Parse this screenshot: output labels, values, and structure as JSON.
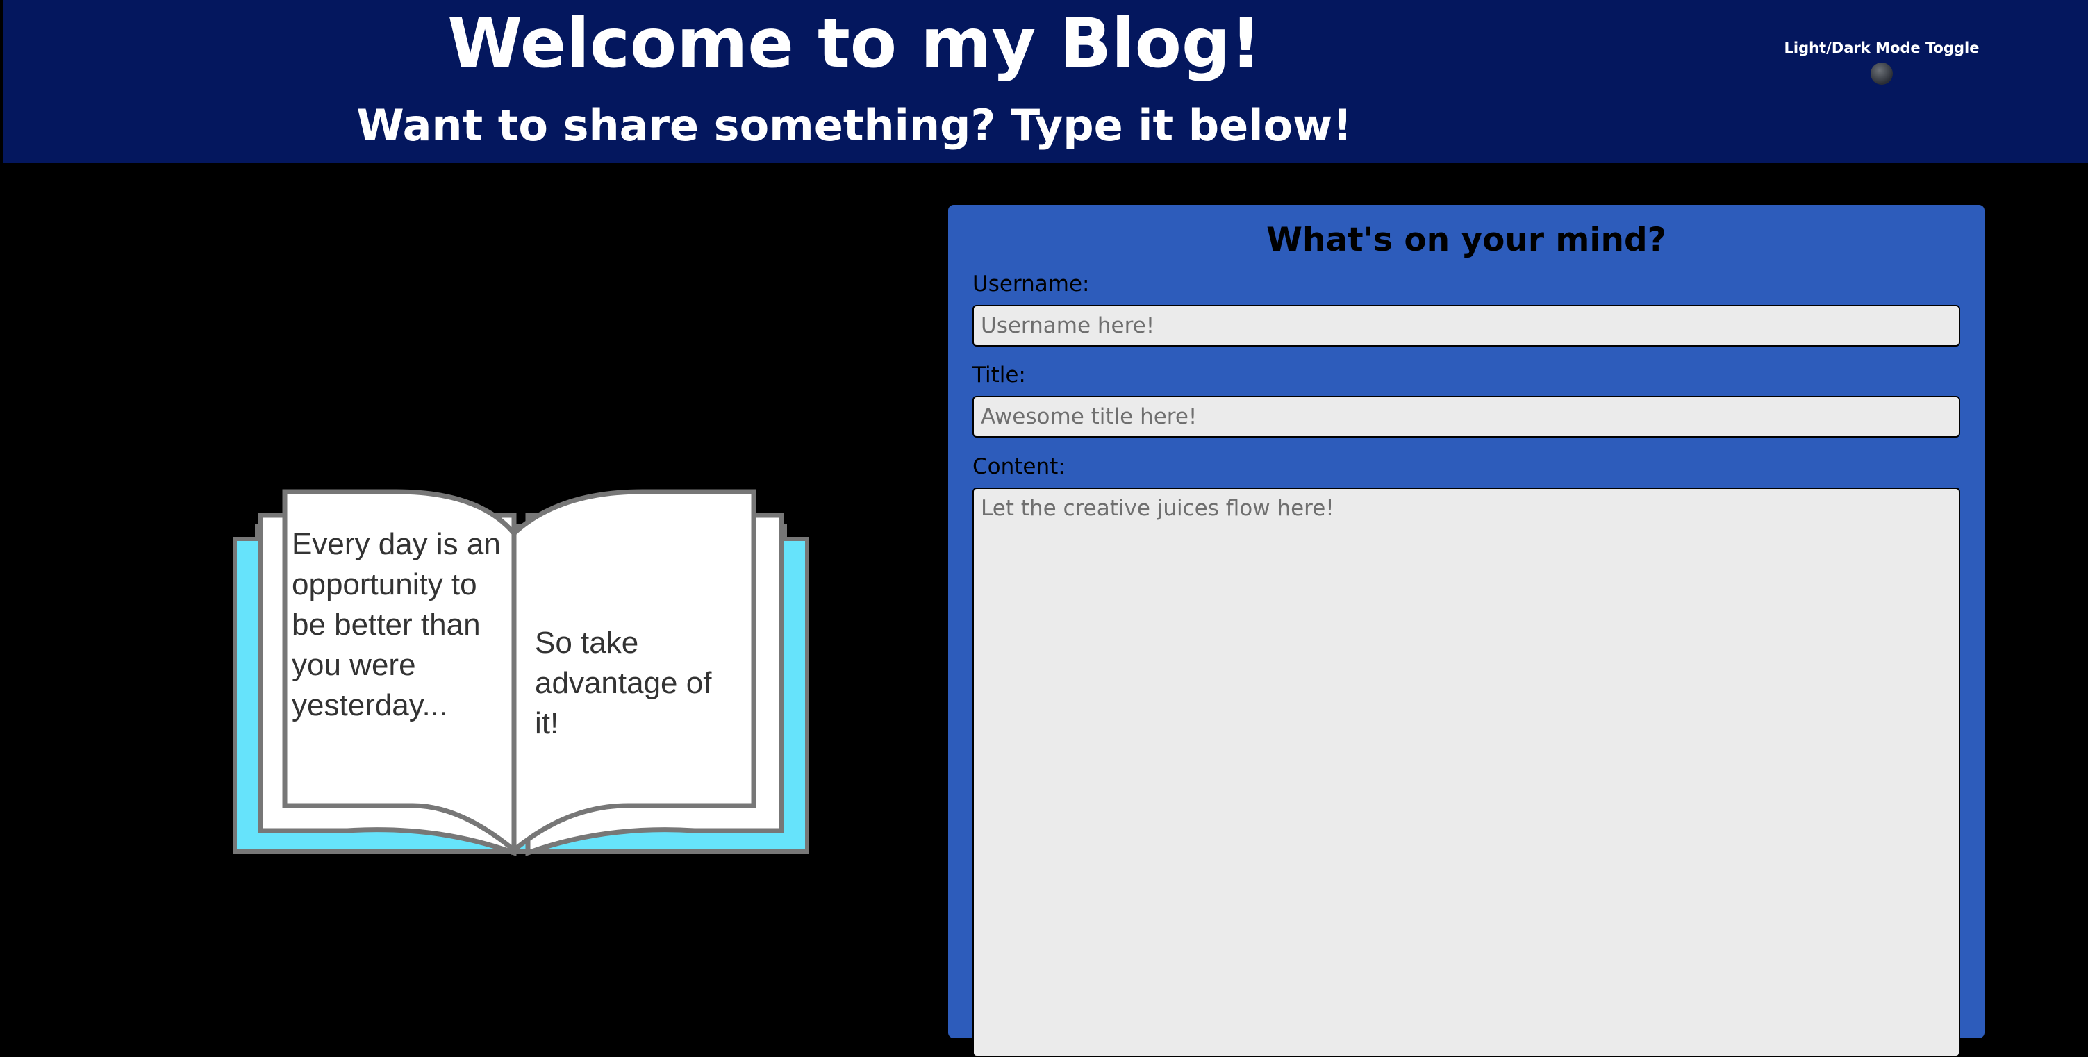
{
  "header": {
    "title": "Welcome to my Blog!",
    "subtitle": "Want to share something? Type it below!",
    "toggle_label": "Light/Dark Mode Toggle"
  },
  "book": {
    "left_page_lines": [
      "Every day is an",
      "opportunity to",
      "be better than",
      "you were",
      "yesterday..."
    ],
    "right_page_lines": [
      "So take",
      "advantage of",
      "it!"
    ]
  },
  "form": {
    "heading": "What's on your mind?",
    "username_label": "Username:",
    "username_placeholder": "Username here!",
    "title_label": "Title:",
    "title_placeholder": "Awesome title here!",
    "content_label": "Content:",
    "content_placeholder": "Let the creative juices flow here!"
  },
  "colors": {
    "header_bg": "#04175e",
    "form_bg": "#2d5cbb",
    "book_cover": "#66e3fb",
    "page_bg": "#000000"
  },
  "icons": {
    "toggle": "circle-toggle-knob",
    "illustration": "open-book-illustration"
  }
}
